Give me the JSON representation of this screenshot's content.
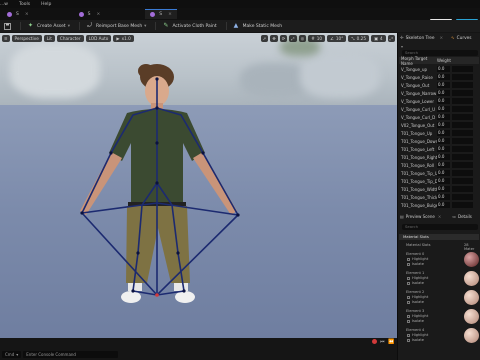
{
  "menu": [
    "...w",
    "Tools",
    "Help"
  ],
  "tabs": [
    {
      "label": "S",
      "color": "#a26cd8"
    },
    {
      "label": "S",
      "color": "#a26cd8"
    },
    {
      "label": "S",
      "color": "#a26cd8"
    }
  ],
  "toolbar": {
    "save_icon": "save-icon",
    "create_asset": "Create Asset",
    "reimport": "Reimport Base Mesh",
    "activate_cloth": "Activate Cloth Paint",
    "make_static": "Make Static Mesh"
  },
  "viewport": {
    "perspective": "Perspective",
    "lit": "Lit",
    "character": "Character",
    "lod": "LOD Auto",
    "speed": "x1.0",
    "snap_values": [
      "10",
      "10°",
      "0.25",
      "4"
    ]
  },
  "skeleton_tree_tab": "Skeleton Tree",
  "curves_tab": "Curves",
  "search_placeholder": "Search",
  "morph_header": {
    "name": "Morph Target Name",
    "weight": "Weight"
  },
  "morph_targets": [
    {
      "name": "V_Tongue_up",
      "weight": "0.0"
    },
    {
      "name": "V_Tongue_Raise",
      "weight": "0.0"
    },
    {
      "name": "V_Tongue_Out",
      "weight": "0.0"
    },
    {
      "name": "V_Tongue_Narrow",
      "weight": "0.0"
    },
    {
      "name": "V_Tongue_Lower",
      "weight": "0.0"
    },
    {
      "name": "V_Tongue_Curl_U",
      "weight": "0.0"
    },
    {
      "name": "V_Tongue_Curl_D",
      "weight": "0.0"
    },
    {
      "name": "V02_Tongue_Out",
      "weight": "0.0"
    },
    {
      "name": "T01_Tongue_Up",
      "weight": "0.0"
    },
    {
      "name": "T01_Tongue_Down",
      "weight": "0.0"
    },
    {
      "name": "T01_Tongue_Left",
      "weight": "0.0"
    },
    {
      "name": "T01_Tongue_Right",
      "weight": "0.0"
    },
    {
      "name": "T01_Tongue_Roll",
      "weight": "0.0"
    },
    {
      "name": "T01_Tongue_Tip_Up",
      "weight": "0.0"
    },
    {
      "name": "T01_Tongue_Tip_Down",
      "weight": "0.0"
    },
    {
      "name": "T01_Tongue_Width",
      "weight": "0.0"
    },
    {
      "name": "T01_Tongue_Thick",
      "weight": "0.0"
    },
    {
      "name": "T01_Tongue_Bulge",
      "weight": "0.0"
    }
  ],
  "lower_tabs": {
    "preview": "Preview Scene",
    "details": "Details"
  },
  "material_slots": {
    "header": "Material Slots",
    "title": "Material Slots",
    "count": "28 Mater",
    "items": [
      "Element 0",
      "Element 1",
      "Element 2",
      "Element 3",
      "Element 4"
    ],
    "highlight": "Highlight",
    "isolate": "Isolate"
  },
  "statusbar": {
    "cmd": "Cmd",
    "placeholder": "Enter Console Command"
  },
  "colors": {
    "accent": "#3a7bd5",
    "active_green": "#8fd18f",
    "bone": "#1c2a70"
  }
}
